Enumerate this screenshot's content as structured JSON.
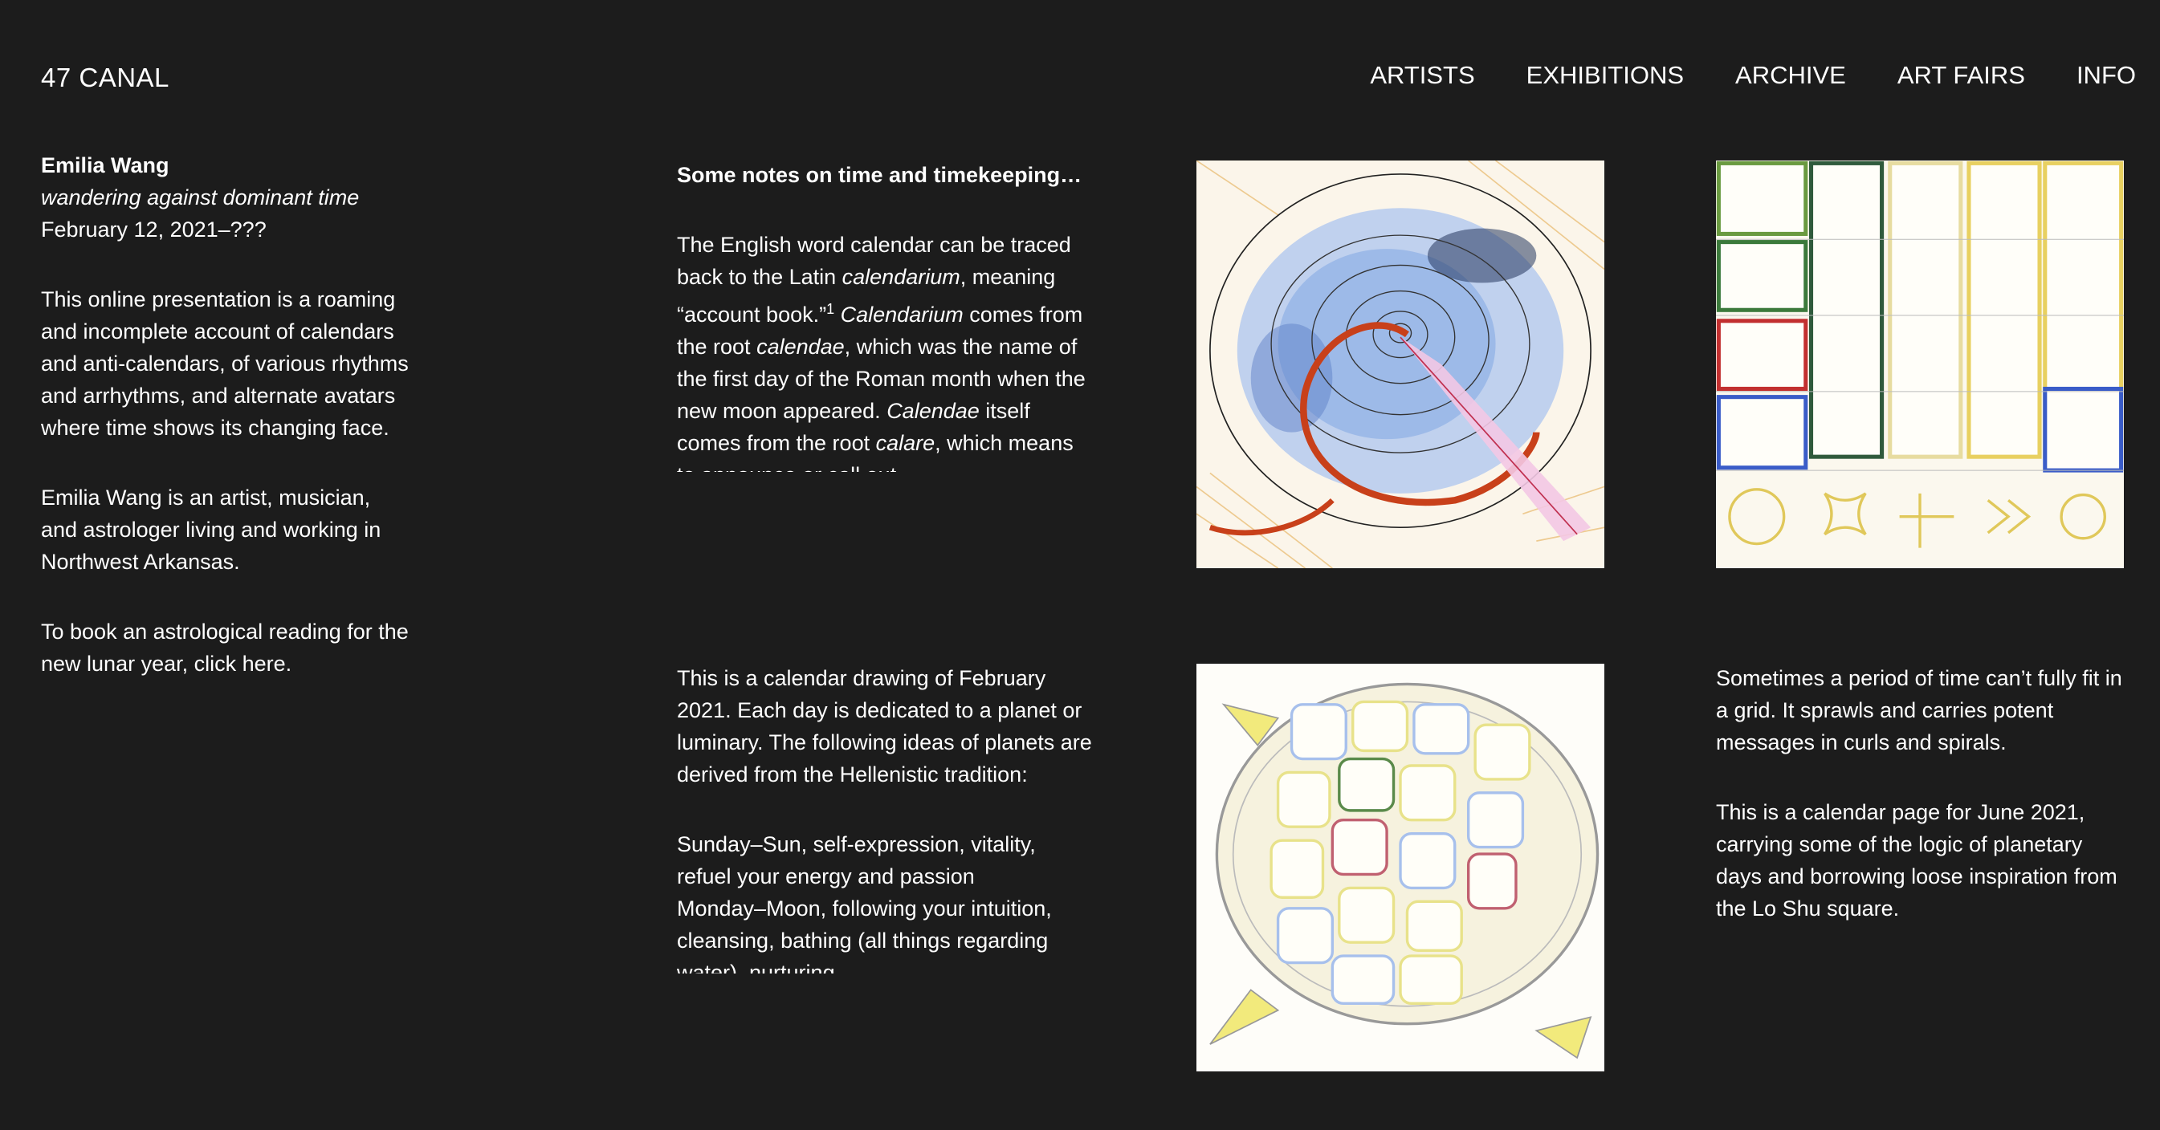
{
  "site": {
    "logo": "47 CANAL"
  },
  "nav": [
    "ARTISTS",
    "EXHIBITIONS",
    "ARCHIVE",
    "ART FAIRS",
    "INFO"
  ],
  "exhibition": {
    "artist": "Emilia Wang",
    "title": "wandering against dominant time",
    "dates": "February 12, 2021–???",
    "intro": "This online presentation is a roaming and incomplete account of calendars and anti-calendars, of various rhythms and arrhythms, and alternate avatars where time shows its changing face.",
    "bio": "Emilia Wang is an artist, musician, and astrologer living and working in Northwest Arkansas.",
    "booking": "To book an astrological reading for the new lunar year, click here."
  },
  "notes": {
    "heading": "Some notes on time and timekeeping…",
    "t1": "The English word calendar can be traced back to the Latin ",
    "t1_em": "calendarium",
    "t2": ", meaning “account book.”",
    "sup": "1",
    "t3_em": " Calendarium",
    "t3": " comes from the root ",
    "t4_em": "calendae",
    "t4": ", which was the name of the first day of the Roman month when the new moon appeared. ",
    "t5_em": "Calendae",
    "t5": " itself comes from the root ",
    "t6_em": "calare",
    "t6": ", which means to announce or call out."
  },
  "feb": {
    "p1": "This is a calendar drawing of February 2021. Each day is dedicated to a planet or luminary. The following ideas of planets are derived from the Hellenistic tradition:",
    "p2a": "Sunday–Sun, self-expression, vitality, refuel your energy and passion",
    "p2b": "Monday–Moon, following your intuition, cleansing, bathing (all things regarding water), nurturing"
  },
  "june": {
    "p1": "Sometimes a period of time can’t fully fit in a grid. It sprawls and carries potent messages in curls and spirals.",
    "p2": "This is a calendar page for June 2021, carrying some of the logic of planetary days and borrowing loose inspiration from the Lo Shu square."
  },
  "colors": {
    "background": "#1c1c1c",
    "text": "#ffffff"
  }
}
